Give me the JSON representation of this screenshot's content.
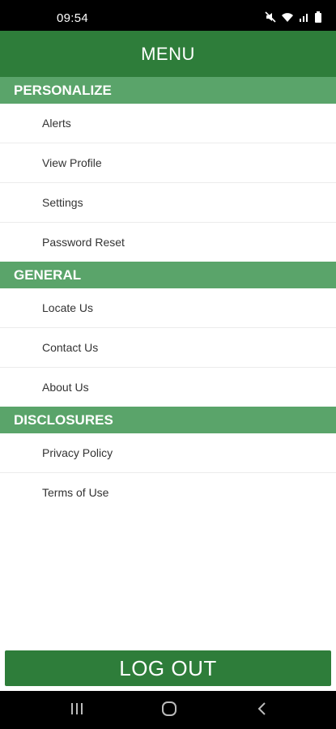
{
  "status_bar": {
    "time": "09:54",
    "icons": [
      "mute-icon",
      "wifi-icon",
      "signal-icon",
      "battery-icon"
    ]
  },
  "header": {
    "title": "MENU"
  },
  "sections": [
    {
      "title": "PERSONALIZE",
      "items": [
        {
          "label": "Alerts"
        },
        {
          "label": "View Profile"
        },
        {
          "label": "Settings"
        },
        {
          "label": "Password Reset"
        }
      ]
    },
    {
      "title": "GENERAL",
      "items": [
        {
          "label": "Locate Us"
        },
        {
          "label": "Contact Us"
        },
        {
          "label": "About Us"
        }
      ]
    },
    {
      "title": "DISCLOSURES",
      "items": [
        {
          "label": "Privacy Policy"
        },
        {
          "label": "Terms of Use"
        }
      ]
    }
  ],
  "logout": {
    "label": "LOG OUT"
  },
  "nav": {
    "buttons": [
      "recent-apps-icon",
      "home-icon",
      "back-icon"
    ]
  },
  "colors": {
    "header_green": "#2e7d3a",
    "section_green": "#5aa46a",
    "logout_green": "#2e7d3a"
  }
}
